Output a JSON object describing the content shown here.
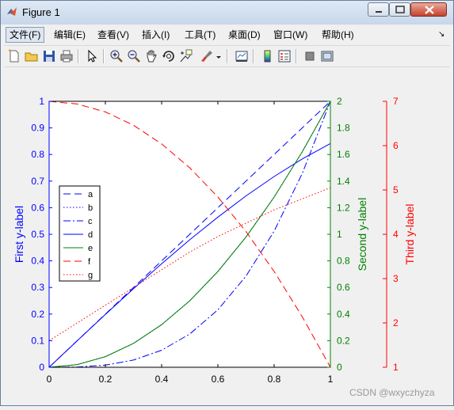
{
  "window": {
    "title": "Figure 1"
  },
  "menu": {
    "items": [
      "文件(F)",
      "编辑(E)",
      "查看(V)",
      "插入(I)",
      "工具(T)",
      "桌面(D)",
      "窗口(W)",
      "帮助(H)"
    ],
    "overflow_glyph": "↘"
  },
  "toolbar": {
    "icons": [
      "new-figure-icon",
      "open-file-icon",
      "save-figure-icon",
      "print-figure-icon",
      "edit-plot-icon",
      "zoom-in-icon",
      "zoom-out-icon",
      "pan-icon",
      "rotate-3d-icon",
      "data-cursor-icon",
      "brush-icon",
      "brush-dropdown-icon",
      "link-plot-icon",
      "insert-colorbar-icon",
      "insert-legend-icon",
      "hide-plot-tools-icon",
      "show-plot-tools-icon"
    ]
  },
  "chart_data": {
    "type": "line",
    "title": "",
    "xlabel": "",
    "xlim": [
      0,
      1
    ],
    "x_ticks": [
      "0",
      "0.2",
      "0.4",
      "0.6",
      "0.8",
      "1"
    ],
    "axes": [
      {
        "ylabel": "First y-label",
        "color": "#0000ff",
        "ylim": [
          0,
          1
        ],
        "ticks": [
          "0",
          "0.1",
          "0.2",
          "0.3",
          "0.4",
          "0.5",
          "0.6",
          "0.7",
          "0.8",
          "0.9",
          "1"
        ]
      },
      {
        "ylabel": "Second y-label",
        "color": "#008000",
        "ylim": [
          0,
          2
        ],
        "ticks": [
          "0",
          "0.2",
          "0.4",
          "0.6",
          "0.8",
          "1",
          "1.2",
          "1.4",
          "1.6",
          "1.8",
          "2"
        ]
      },
      {
        "ylabel": "Third y-label",
        "color": "#ff0000",
        "ylim": [
          1,
          7
        ],
        "ticks": [
          "1",
          "2",
          "3",
          "4",
          "5",
          "6",
          "7"
        ]
      }
    ],
    "legend": {
      "placement": "left",
      "entries": [
        "a",
        "b",
        "c",
        "d",
        "e",
        "f",
        "g"
      ]
    },
    "x": [
      0,
      0.1,
      0.2,
      0.3,
      0.4,
      0.5,
      0.6,
      0.7,
      0.8,
      0.9,
      1.0
    ],
    "series": [
      {
        "name": "a",
        "axis": 0,
        "color": "#0000ff",
        "style": "dashed",
        "values": [
          0,
          0.1,
          0.2,
          0.3,
          0.4,
          0.5,
          0.6,
          0.7,
          0.8,
          0.9,
          1.0
        ]
      },
      {
        "name": "b",
        "axis": 0,
        "color": "#0000ff",
        "style": "dotted",
        "values": [
          0,
          0.01,
          0.04,
          0.09,
          0.16,
          0.25,
          0.36,
          0.49,
          0.64,
          0.81,
          1.0
        ]
      },
      {
        "name": "c",
        "axis": 0,
        "color": "#0000ff",
        "style": "dashdot",
        "values": [
          0,
          0.001,
          0.008,
          0.027,
          0.064,
          0.125,
          0.216,
          0.343,
          0.512,
          0.729,
          1.0
        ]
      },
      {
        "name": "d",
        "axis": 0,
        "color": "#0000ff",
        "style": "solid",
        "values": [
          0,
          0.0998,
          0.1987,
          0.2955,
          0.3894,
          0.4794,
          0.5646,
          0.6442,
          0.7174,
          0.7833,
          0.8415
        ]
      },
      {
        "name": "e",
        "axis": 1,
        "color": "#008000",
        "style": "solid",
        "values": [
          0,
          0.02,
          0.08,
          0.18,
          0.32,
          0.5,
          0.72,
          0.98,
          1.28,
          1.62,
          2.0
        ]
      },
      {
        "name": "f",
        "axis": 2,
        "color": "#ff0000",
        "style": "dashed",
        "values": [
          7.0,
          6.94,
          6.76,
          6.46,
          6.04,
          5.5,
          4.84,
          4.06,
          3.16,
          2.14,
          1.0
        ]
      },
      {
        "name": "g",
        "axis": 2,
        "color": "#ff0000",
        "style": "dotted",
        "values": [
          1.6,
          2.0,
          2.4,
          2.8,
          3.2,
          3.6,
          3.95,
          4.25,
          4.55,
          4.8,
          5.05
        ]
      }
    ]
  },
  "watermark": "CSDN @wxyczhyza"
}
